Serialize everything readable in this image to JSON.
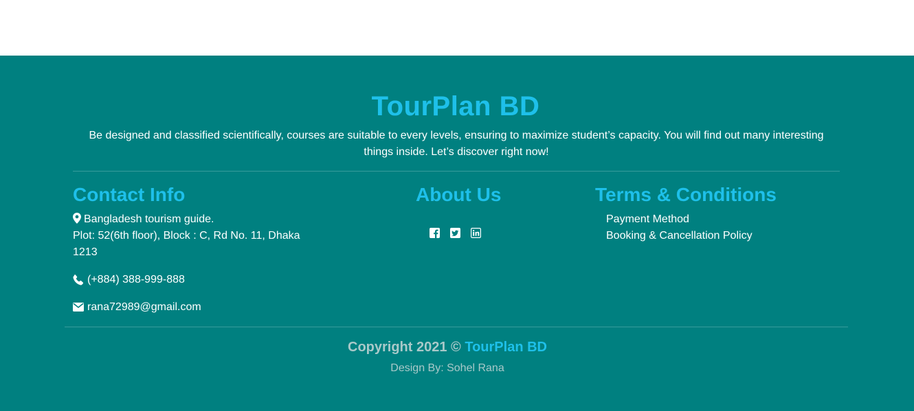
{
  "colors": {
    "footer_bg": "#008080",
    "accent": "#1ec0ea",
    "text": "#ffffff",
    "muted": "#a9c9c9"
  },
  "brand": {
    "title": "TourPlan BD",
    "description": "Be designed and classified scientifically, courses are suitable to every levels, ensuring to maximize student’s capacity. You will find out many interesting things inside. Let’s discover right now!"
  },
  "contact": {
    "heading": "Contact Info",
    "address_title": "Bangladesh tourism guide.",
    "address_line1": "Plot: 52(6th floor), Block : C, Rd No. 11, Dhaka",
    "address_line2": "1213",
    "phone": "(+884) 388-999-888",
    "email": "rana72989@gmail.com",
    "icons": [
      "location-icon",
      "phone-icon",
      "envelope-icon"
    ]
  },
  "about": {
    "heading": "About Us",
    "social_icons": [
      "facebook-icon",
      "twitter-icon",
      "linkedin-icon"
    ]
  },
  "terms": {
    "heading": "Terms & Conditions",
    "links": [
      "Payment Method",
      "Booking & Cancellation Policy"
    ]
  },
  "bottom": {
    "copyright_prefix": "Copyright 2021 ©",
    "copyright_brand": "TourPlan BD",
    "design_by": "Design By: Sohel Rana"
  }
}
